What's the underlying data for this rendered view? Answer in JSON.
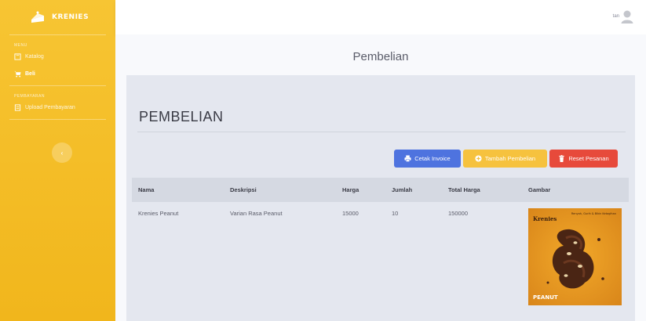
{
  "sidebar": {
    "brand": "KRENIES",
    "section_main": "MENU",
    "items": [
      {
        "label": "Katalog",
        "icon": "book-icon",
        "active": false
      },
      {
        "label": "Beli",
        "icon": "cart-icon",
        "active": true
      }
    ],
    "section_payment": "PEMBAYARAN",
    "payment_item": {
      "label": "Upload Pembayaran",
      "icon": "upload-icon"
    },
    "toggle_glyph": "‹"
  },
  "topbar": {
    "user_name": "tan"
  },
  "page": {
    "title": "Pembelian",
    "card_title": "PEMBELIAN"
  },
  "buttons": {
    "print": "Cetak Invoice",
    "add": "Tambah Pembelian",
    "reset": "Reset Pesanan"
  },
  "table": {
    "headers": [
      "Nama",
      "Deskripsi",
      "Harga",
      "Jumlah",
      "Total Harga",
      "Gambar"
    ],
    "rows": [
      {
        "nama": "Krenies Peanut",
        "deskripsi": "Varian Rasa Peanut",
        "harga": "15000",
        "jumlah": "10",
        "total": "150000",
        "image": {
          "brand": "Krenies",
          "tagline": "Renyah, Gurih & Bikin Ketagihan",
          "flavor": "PEANUT"
        }
      }
    ]
  },
  "colors": {
    "sidebar": "#f6c23e",
    "primary": "#4e73df",
    "warning": "#f6c23e",
    "danger": "#e74a3b"
  }
}
